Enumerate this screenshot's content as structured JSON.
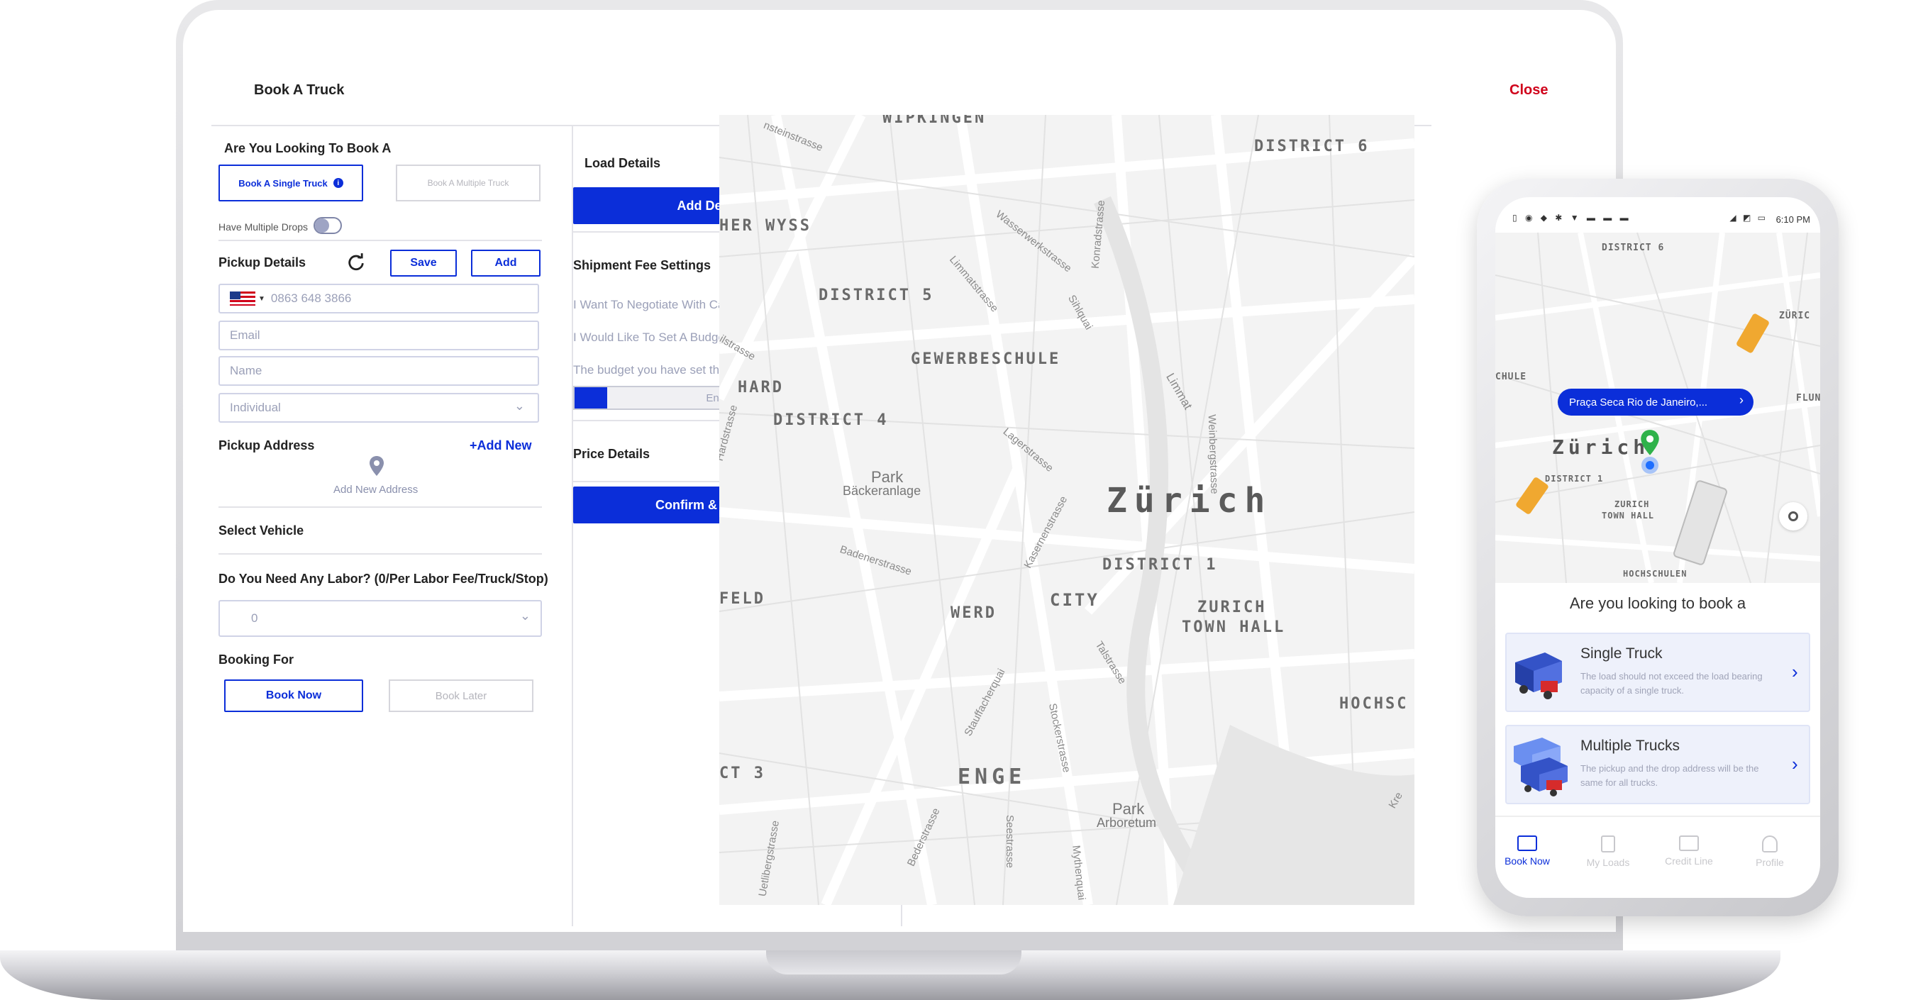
{
  "header": {
    "title": "Book A Truck",
    "close_label": "Close"
  },
  "booking_type": {
    "question": "Are You Looking To Book A",
    "single_label": "Book A Single Truck",
    "multiple_label": "Book A Multiple Truck",
    "multiple_drops_label": "Have Multiple Drops"
  },
  "pickup": {
    "title": "Pickup Details",
    "save_label": "Save",
    "add_label": "Add",
    "phone_placeholder": "0863 648 3866",
    "email_placeholder": "Email",
    "name_placeholder": "Name",
    "type_value": "Individual",
    "address_title": "Pickup Address",
    "add_new_label": "+Add New",
    "add_new_address": "Add New Address"
  },
  "vehicle": {
    "title": "Select Vehicle"
  },
  "labor": {
    "title": "Do You Need Any Labor? (0/Per Labor Fee/Truck/Stop)",
    "value": "0"
  },
  "booking_for": {
    "title": "Booking For",
    "now_label": "Book Now",
    "later_label": "Book Later"
  },
  "load": {
    "title": "Load Details",
    "add_stop_label": "Add Delivery Stop"
  },
  "shipment": {
    "title": "Shipment Fee Settings",
    "negotiate_label": "I Want To Negotiate With Carriers",
    "budget_label": "I Would Like To Set A Budget For This Shipment",
    "budget_hint": "The budget you have set this load",
    "budget_placeholder": "Enter your budget"
  },
  "price": {
    "title": "Price Details",
    "confirm_label": "Confirm & Dispatch Load"
  },
  "map": {
    "labels": [
      "WIPKINGEN",
      "DISTRICT 6",
      "HER WYSS",
      "DISTRICT 5",
      "GEWERBESCHULE",
      "HARD",
      "DISTRICT 4",
      "Zürich",
      "DISTRICT 1",
      "FELD",
      "WERD",
      "CITY",
      "ZURICH",
      "TOWN HALL",
      "HOCHSC",
      "CT 3",
      "ENGE"
    ],
    "parks": [
      "Park",
      "Bäckeranlage",
      "Park",
      "Arboretum"
    ],
    "streets": [
      "Wasserwerkstrasse",
      "Limmatstrasse",
      "Konradstrasse",
      "Sihlquai",
      "Limmat",
      "Weinbergstrasse",
      "Lagerstrasse",
      "Hardstrasse",
      "Badenerstrasse",
      "Kasernenstrasse",
      "Stauffacherquai",
      "Talstrasse",
      "Stockerstrasse",
      "Uetlibergstrasse",
      "Bederstrasse",
      "Seestrasse",
      "Mythenquai",
      "Kre",
      "ilstrasse",
      "nsteinstrasse"
    ]
  },
  "phone": {
    "time": "6:10 PM",
    "map_labels": [
      "DISTRICT 6",
      "ZÜRIC",
      "CHULE",
      "FLUN",
      "Zürich",
      "DISTRICT 1",
      "ZURICH",
      "TOWN HALL",
      "HOCHSCHULEN"
    ],
    "pill_text": "Praça Seca Rio de Janeiro,...",
    "question": "Are you looking to book a",
    "single_title": "Single Truck",
    "single_desc": "The load should not exceed the load bearing capacity of a single truck.",
    "multi_title": "Multiple Trucks",
    "multi_desc": "The pickup and the drop address will be the same for all trucks.",
    "nav": [
      "Book Now",
      "My Loads",
      "Credit Line",
      "Profile"
    ]
  },
  "colors": {
    "primary": "#0b2ed9",
    "close": "#d0021b",
    "pin": "#2fb24a"
  }
}
